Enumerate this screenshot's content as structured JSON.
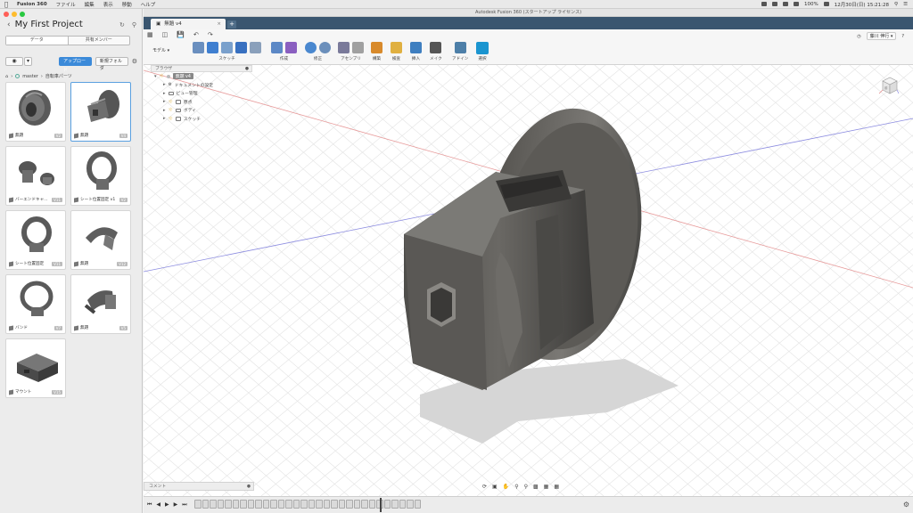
{
  "menubar": {
    "app": "Fusion 360",
    "items": [
      "ファイル",
      "編集",
      "表示",
      "移動",
      "ヘルプ"
    ],
    "battery": "100%",
    "clock": "12月30日(日)  15:21:28"
  },
  "data_panel": {
    "title": "My First Project",
    "tabs": [
      "データ",
      "共有メンバー"
    ],
    "upload_label": "アップロード",
    "new_folder_label": "新規フォルダ",
    "breadcrumb": [
      "master",
      "自転車パーツ"
    ],
    "items": [
      {
        "label": "無題",
        "version": "V2",
        "icon": "disc-part-icon"
      },
      {
        "label": "無題",
        "version": "V4",
        "icon": "connector-part-icon"
      },
      {
        "label": "バーエンドキャ...",
        "version": "V11",
        "icon": "bar-end-cap-icon"
      },
      {
        "label": "シート位置固定 v1",
        "version": "V2",
        "icon": "seat-clamp-icon"
      },
      {
        "label": "シート位置固定",
        "version": "V11",
        "icon": "seat-clamp-icon"
      },
      {
        "label": "無題",
        "version": "V12",
        "icon": "bent-bracket-icon"
      },
      {
        "label": "バンド",
        "version": "V7",
        "icon": "band-clamp-icon"
      },
      {
        "label": "無題",
        "version": "V5",
        "icon": "clip-part-icon"
      },
      {
        "label": "マウント",
        "version": "V15",
        "icon": "mount-box-icon"
      }
    ]
  },
  "window": {
    "title": "Autodesk Fusion 360 (スタートアップ ライセンス)",
    "tab_label": "無題 v4"
  },
  "toolbar": {
    "workspace": "モデル",
    "groups": [
      {
        "label": "スケッチ",
        "colors": [
          "#6a8fbf",
          "#3f7fd0",
          "#7aa0cc",
          "#3870c0"
        ]
      },
      {
        "label": "作成",
        "colors": [
          "#5c88c6",
          "#8a5fc0"
        ]
      },
      {
        "label": "修正",
        "colors": [
          "#4a88cf",
          "#6b8fbb"
        ]
      },
      {
        "label": "アセンブリ",
        "colors": [
          "#7a7a9a",
          "#a0a0a0"
        ]
      },
      {
        "label": "構築",
        "colors": [
          "#d88a2b"
        ]
      },
      {
        "label": "検査",
        "colors": [
          "#e0b040"
        ]
      },
      {
        "label": "挿入",
        "colors": [
          "#3f7fc0"
        ]
      },
      {
        "label": "メイク",
        "colors": [
          "#555555"
        ]
      },
      {
        "label": "アドイン",
        "colors": [
          "#4d7fa8"
        ]
      },
      {
        "label": "選択",
        "colors": [
          "#1b95d0"
        ]
      }
    ],
    "user": "藤川 伸行"
  },
  "browser": {
    "header": "ブラウザ",
    "root": "無題 v4",
    "nodes": [
      {
        "label": "ドキュメントの設定",
        "bulb": false,
        "kind": "gear"
      },
      {
        "label": "ビュー管理",
        "bulb": false,
        "kind": "folder"
      },
      {
        "label": "原点",
        "bulb": true,
        "kind": "folder"
      },
      {
        "label": "ボディ",
        "bulb": true,
        "kind": "folder"
      },
      {
        "label": "スケッチ",
        "bulb": true,
        "kind": "folder"
      }
    ]
  },
  "viewcube": {
    "face": "前"
  },
  "comments": {
    "label": "コメント"
  },
  "timeline": {
    "item_count": 30
  }
}
